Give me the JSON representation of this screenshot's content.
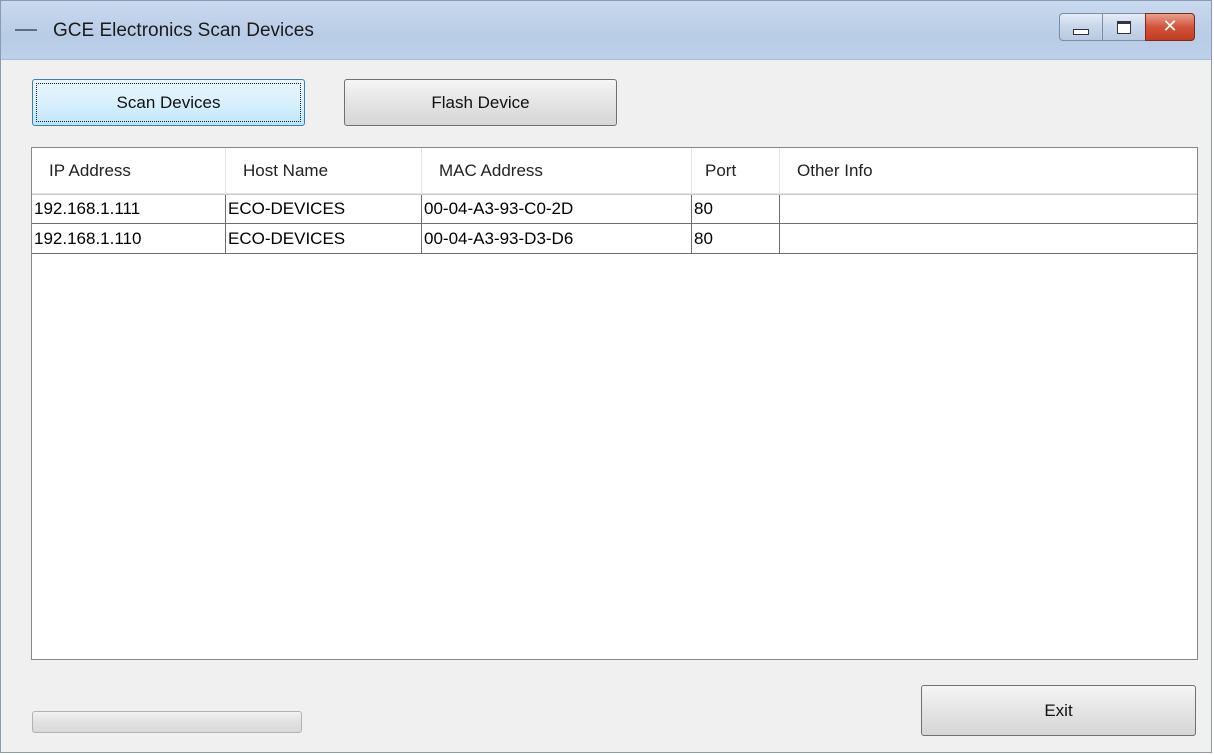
{
  "window": {
    "title": "GCE Electronics Scan Devices",
    "controls": {
      "minimize_icon": "minimize-icon",
      "maximize_icon": "maximize-icon",
      "close_icon": "close-icon",
      "close_glyph": "✕"
    }
  },
  "toolbar": {
    "scan_label": "Scan Devices",
    "flash_label": "Flash Device"
  },
  "device_list": {
    "columns": [
      "IP Address",
      "Host Name",
      "MAC Address",
      "Port",
      "Other Info"
    ],
    "rows": [
      [
        "192.168.1.111",
        "ECO-DEVICES",
        "00-04-A3-93-C0-2D",
        "80",
        ""
      ],
      [
        "192.168.1.110",
        "ECO-DEVICES",
        "00-04-A3-93-D3-D6",
        "80",
        ""
      ]
    ]
  },
  "footer": {
    "exit_label": "Exit",
    "progress_percent": 0
  },
  "colors": {
    "title_bar": "#c9d9ee",
    "close_button": "#d2533a",
    "focused_button": "#bee6fd"
  }
}
